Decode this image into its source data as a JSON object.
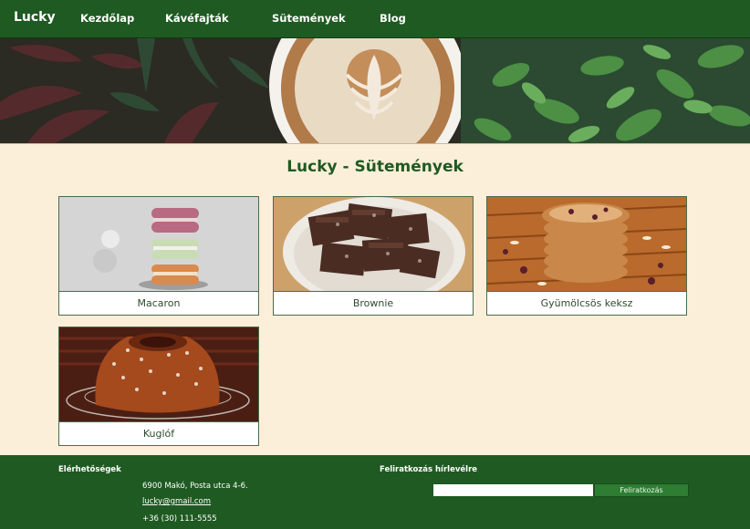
{
  "nav": {
    "brand": "Lucky",
    "links": [
      "Kezdőlap",
      "Kávéfajták",
      "Sütemények",
      "Blog"
    ]
  },
  "main": {
    "title": "Lucky - Sütemények",
    "cards": [
      {
        "label": "Macaron"
      },
      {
        "label": "Brownie"
      },
      {
        "label": "Gyümölcsös keksz"
      },
      {
        "label": "Kuglóf"
      }
    ]
  },
  "footer": {
    "contacts_heading": "Elérhetőségek",
    "address": "6900 Makó, Posta utca 4-6.",
    "email": "lucky@gmail.com",
    "phone": "+36 (30) 111-5555",
    "newsletter_heading": "Feliratkozás hírlevélre",
    "subscribe_label": "Feliratkozás",
    "email_input_value": ""
  },
  "colors": {
    "nav_bg": "#1f5a22",
    "page_bg": "#fcefd9",
    "title": "#1f5a22"
  }
}
